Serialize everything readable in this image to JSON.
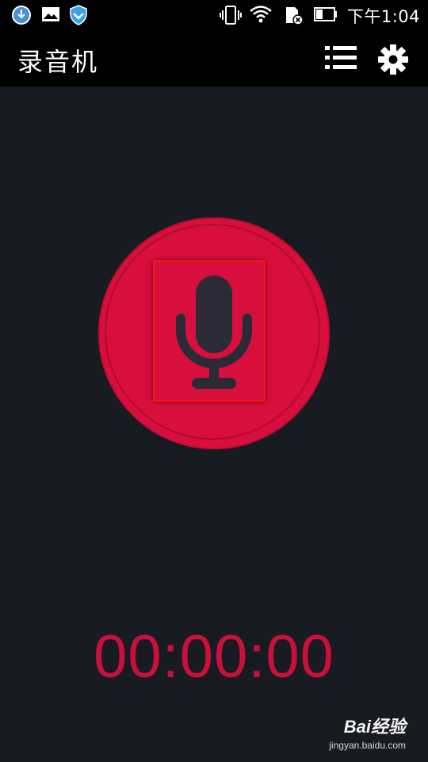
{
  "status_bar": {
    "time": "下午1:04",
    "icons": [
      "download-shield-icon",
      "image-notification-icon",
      "security-shield-icon",
      "vibrate-icon",
      "wifi-icon",
      "sd-card-error-icon",
      "battery-icon"
    ]
  },
  "app_bar": {
    "title": "录音机",
    "actions": [
      "list-icon",
      "gear-icon"
    ]
  },
  "recorder": {
    "button_icon": "microphone-icon",
    "accent_color": "#d80f3d",
    "timer": "00:00:00"
  },
  "watermark": {
    "brand": "Bai经验",
    "url": "jingyan.baidu.com"
  }
}
